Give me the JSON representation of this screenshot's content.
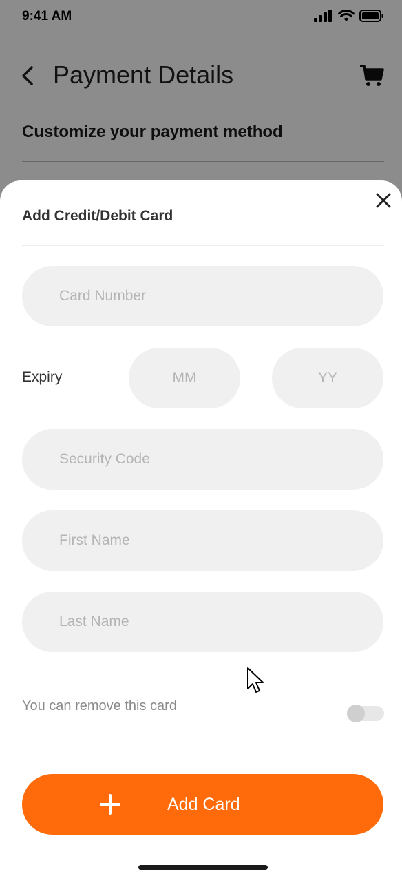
{
  "status_bar": {
    "time": "9:41 AM"
  },
  "header": {
    "title": "Payment Details"
  },
  "subheading": "Customize your payment method",
  "sheet": {
    "title": "Add Credit/Debit Card",
    "card_number_placeholder": "Card Number",
    "expiry_label": "Expiry",
    "month_placeholder": "MM",
    "year_placeholder": "YY",
    "security_code_placeholder": "Security Code",
    "first_name_placeholder": "First Name",
    "last_name_placeholder": "Last Name",
    "remove_card_label": "You can remove this card",
    "remove_card_toggle_on": false,
    "add_button_label": "Add Card"
  },
  "colors": {
    "accent": "#ff6b0a",
    "field_bg": "#f0f0f0",
    "overlay": "rgba(0,0,0,0.45)"
  },
  "icons": [
    "signal-icon",
    "wifi-icon",
    "battery-icon",
    "back-arrow-icon",
    "cart-icon",
    "close-icon",
    "plus-icon",
    "mouse-cursor-icon"
  ]
}
